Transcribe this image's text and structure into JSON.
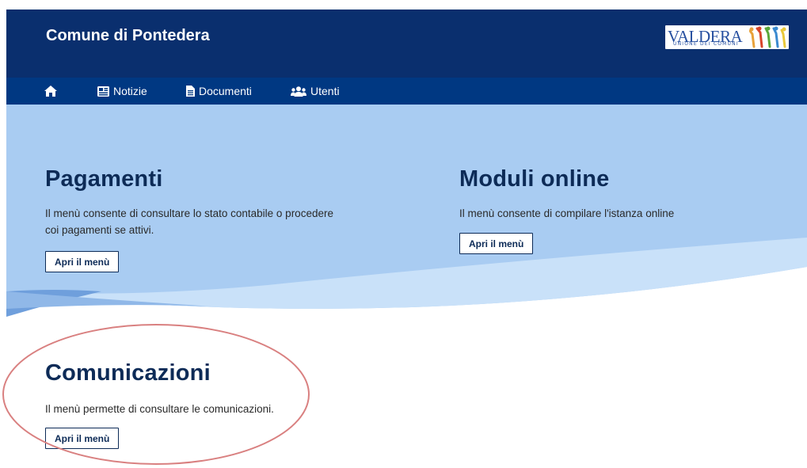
{
  "header": {
    "site_title": "Comune di Pontedera",
    "logo": {
      "name": "VALDERA",
      "subtitle": "UNIONE DEI COMUNI"
    }
  },
  "nav": {
    "items": [
      {
        "label": "",
        "icon": "home-icon"
      },
      {
        "label": "Notizie",
        "icon": "newspaper-icon"
      },
      {
        "label": "Documenti",
        "icon": "file-icon"
      },
      {
        "label": "Utenti",
        "icon": "users-icon"
      }
    ]
  },
  "sections": [
    {
      "title": "Pagamenti",
      "description_lines": [
        "Il menù consente di consultare lo stato contabile o procedere",
        "coi pagamenti se attivi."
      ],
      "button": "Apri il menù"
    },
    {
      "title": "Moduli online",
      "description_lines": [
        "Il menù consente di compilare l'istanza online"
      ],
      "button": "Apri il menù"
    },
    {
      "title": "Comunicazioni",
      "description_lines": [
        "Il menù permette di consultare le comunicazioni."
      ],
      "button": "Apri il menù"
    }
  ],
  "colors": {
    "header_bg": "#0a2f6e",
    "nav_bg": "#003882",
    "hero_bg": "#a9ccf2",
    "title_color": "#0d2b57",
    "annotation": "#d98080"
  }
}
